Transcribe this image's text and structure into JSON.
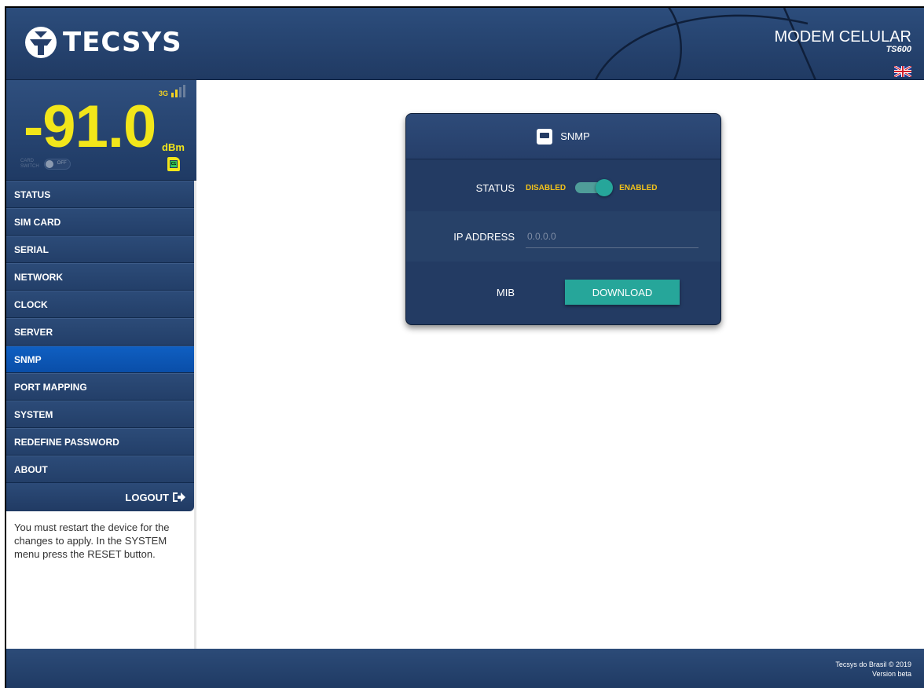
{
  "header": {
    "brand": "TECSYS",
    "product_name": "MODEM CELULAR",
    "product_model": "TS600",
    "language_flag": "uk-flag-icon"
  },
  "signal": {
    "network": "3G",
    "bars_total": 4,
    "bars_active": 2,
    "value": "-91.0",
    "unit": "dBm",
    "card_switch_label_line1": "CARD",
    "card_switch_label_line2": "SWITCH",
    "card_switch_state": "OFF",
    "sim_label": "C1"
  },
  "sidebar": {
    "items": [
      {
        "label": "STATUS"
      },
      {
        "label": "SIM CARD"
      },
      {
        "label": "SERIAL"
      },
      {
        "label": "NETWORK"
      },
      {
        "label": "CLOCK"
      },
      {
        "label": "SERVER"
      },
      {
        "label": "SNMP",
        "active": true
      },
      {
        "label": "PORT MAPPING"
      },
      {
        "label": "SYSTEM"
      },
      {
        "label": "REDEFINE PASSWORD"
      },
      {
        "label": "ABOUT"
      }
    ],
    "logout_label": "LOGOUT",
    "restart_note": "You must restart the device for the changes to apply. In the SYSTEM menu press the RESET button."
  },
  "snmp": {
    "title": "SNMP",
    "status_label": "STATUS",
    "disabled_label": "DISABLED",
    "enabled_label": "ENABLED",
    "enabled": true,
    "ip_label": "IP ADDRESS",
    "ip_placeholder": "0.0.0.0",
    "mib_label": "MIB",
    "download_label": "DOWNLOAD"
  },
  "footer": {
    "copyright": "Tecsys do Brasil © 2019",
    "version": "Version beta"
  },
  "colors": {
    "header_bg": "#233f69",
    "active_menu": "#0a5cbf",
    "signal_text": "#f2e61a",
    "accent_teal": "#26a69a",
    "toggle_text": "#f2c21a"
  }
}
